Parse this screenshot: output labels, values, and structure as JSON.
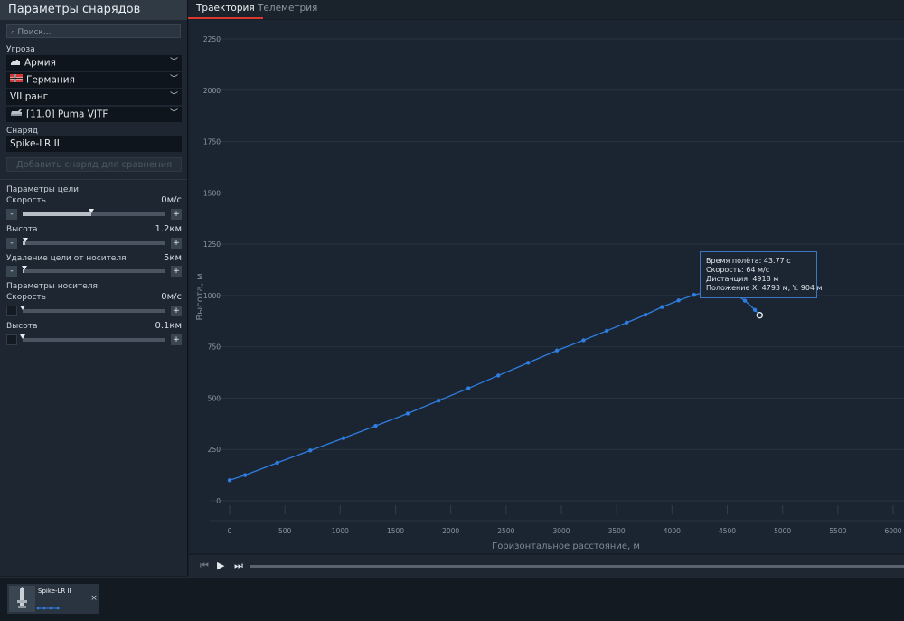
{
  "sidebar": {
    "title": "Параметры снарядов",
    "search_placeholder": "Поиск...",
    "threat_label": "Угроза",
    "selects": [
      {
        "value": "Армия",
        "icon": "tank-silhouette-icon"
      },
      {
        "value": "Германия",
        "icon": "germany-flag-icon"
      },
      {
        "value": "VII ранг"
      },
      {
        "value": "[11.0] Puma VJTF",
        "icon": "vehicle-icon"
      }
    ],
    "shell_label": "Снаряд",
    "shell_value": "Spike-LR II",
    "add_button": "Добавить снаряд для сравнения",
    "target_params_label": "Параметры цели:",
    "carrier_params_label": "Параметры носителя:",
    "sliders": [
      {
        "label": "Скорость",
        "value": "0м/с",
        "level": 0.48,
        "minus_enabled": true
      },
      {
        "label": "Высота",
        "value": "1.2км",
        "level": 0.02,
        "minus_enabled": true
      },
      {
        "label": "Удаление цели от носителя",
        "value": "5км",
        "level": 0.01,
        "minus_enabled": true
      },
      {
        "label": "Скорость",
        "value": "0м/с",
        "level": 0.0,
        "minus_enabled": false
      },
      {
        "label": "Высота",
        "value": "0.1км",
        "level": 0.0,
        "minus_enabled": false
      }
    ],
    "minus_symbol": "-",
    "plus_symbol": "+"
  },
  "tabs": [
    {
      "label": "Траектория",
      "active": true
    },
    {
      "label": "Телеметрия",
      "active": false
    }
  ],
  "chart_data": {
    "type": "line",
    "xlabel": "Горизонтальное расстояние, м",
    "ylabel": "Высота, м",
    "xlim": [
      0,
      6000
    ],
    "ylim": [
      0,
      2250
    ],
    "xticks": [
      0,
      500,
      1000,
      1500,
      2000,
      2500,
      3000,
      3500,
      4000,
      4500,
      5000,
      5500,
      6000
    ],
    "yticks": [
      0,
      250,
      500,
      750,
      1000,
      1250,
      1500,
      1750,
      2000,
      2250
    ],
    "grid": true,
    "line_color": "#2f7de1",
    "series": [
      {
        "x": [
          0,
          140,
          430,
          730,
          1030,
          1320,
          1610,
          1890,
          2160,
          2430,
          2700,
          2960,
          3200,
          3410,
          3590,
          3760,
          3910,
          4060,
          4200,
          4330,
          4450,
          4560,
          4660,
          4750,
          4793
        ],
        "y": [
          100,
          125,
          185,
          245,
          305,
          365,
          425,
          488,
          548,
          610,
          672,
          732,
          782,
          828,
          868,
          906,
          944,
          976,
          1003,
          1020,
          1025,
          1010,
          975,
          930,
          904
        ]
      }
    ],
    "highlight_point": {
      "x": 4793,
      "y": 904
    },
    "tooltip": [
      "Время полёта: 43.77 с",
      "Скорость: 64 м/с",
      "Дистанция: 4918 м",
      "Положение X: 4793 м, Y: 904 м"
    ]
  },
  "player": {
    "prev_icon": "⏮",
    "play_icon": "▶",
    "next_icon": "⏭"
  },
  "compare_card": {
    "name": "Spike-LR II",
    "close_icon": "×"
  }
}
